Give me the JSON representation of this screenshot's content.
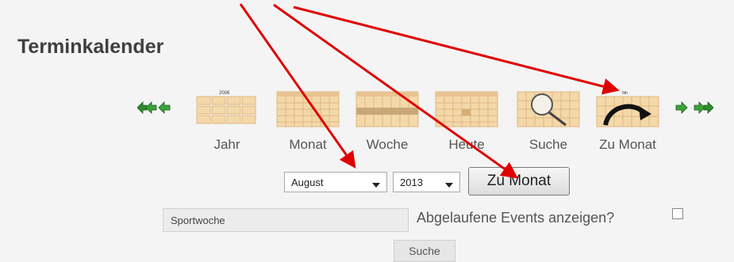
{
  "page": {
    "title": "Terminkalender"
  },
  "views": [
    {
      "label": "Jahr",
      "icon": "calendar-year-icon",
      "icon_text": "2006"
    },
    {
      "label": "Monat",
      "icon": "calendar-month-icon"
    },
    {
      "label": "Woche",
      "icon": "calendar-week-icon"
    },
    {
      "label": "Heute",
      "icon": "calendar-today-icon"
    },
    {
      "label": "Suche",
      "icon": "calendar-search-icon"
    },
    {
      "label": "Zu Monat",
      "icon": "calendar-goto-month-icon",
      "icon_text": "5th"
    }
  ],
  "goto": {
    "month_value": "August",
    "year_value": "2013",
    "button_label": "Zu Monat"
  },
  "search": {
    "value": "Sportwoche",
    "expired_label": "Abgelaufene Events anzeigen?",
    "expired_checked": false,
    "button_label": "Suche"
  },
  "colors": {
    "background": "#f4f4f4",
    "calendar_tile": "#f3d8aa",
    "calendar_grid": "#e2b77e",
    "nav_arrow": "#2e8b2e",
    "annotation_arrow": "#e00000"
  }
}
